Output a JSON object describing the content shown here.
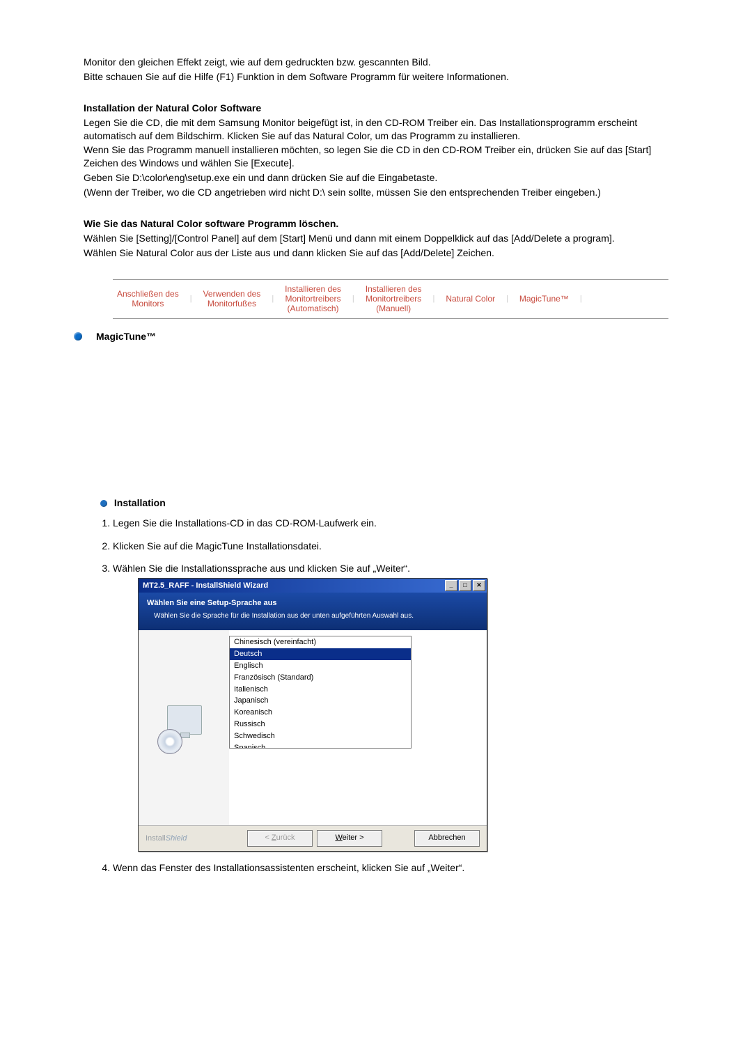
{
  "intro": {
    "p1": "Monitor den gleichen Effekt zeigt, wie auf dem gedruckten bzw. gescannten Bild.",
    "p2": "Bitte schauen Sie auf die Hilfe (F1) Funktion in dem Software Programm für weitere Informationen."
  },
  "install_nc": {
    "heading": "Installation der Natural Color Software",
    "p1": "Legen Sie die CD, die mit dem Samsung Monitor beigefügt ist, in den CD-ROM Treiber ein. Das Installationsprogramm erscheint automatisch auf dem Bildschirm. Klicken Sie auf das Natural Color, um das Programm zu installieren.",
    "p2": "Wenn Sie das Programm manuell installieren möchten, so legen Sie die CD in den CD-ROM Treiber ein, drücken Sie auf das [Start] Zeichen des Windows und wählen Sie [Execute].",
    "p3": "Geben Sie D:\\color\\eng\\setup.exe ein und dann drücken Sie auf die Eingabetaste.",
    "p4": "(Wenn der Treiber, wo die CD angetrieben wird nicht D:\\ sein sollte, müssen Sie den entsprechenden Treiber eingeben.)"
  },
  "remove_nc": {
    "heading": "Wie Sie das Natural Color software Programm löschen.",
    "p1": "Wählen Sie [Setting]/[Control Panel] auf dem [Start] Menü und dann mit einem Doppelklick auf das [Add/Delete a program].",
    "p2": "Wählen Sie Natural Color aus der Liste aus und dann klicken Sie auf das [Add/Delete] Zeichen."
  },
  "nav": [
    "Anschließen des\nMonitors",
    "Verwenden des\nMonitorfußes",
    "Installieren des\nMonitortreibers\n(Automatisch)",
    "Installieren des\nMonitortreibers\n(Manuell)",
    "Natural Color",
    "MagicTune™"
  ],
  "magictune": {
    "heading": "MagicTune™",
    "installation_heading": "Installation",
    "steps": [
      "Legen Sie die Installations-CD in das CD-ROM-Laufwerk ein.",
      "Klicken Sie auf die MagicTune Installationsdatei.",
      "Wählen Sie die Installationssprache aus und klicken Sie auf „Weiter“.",
      "Wenn das Fenster des Installationsassistenten erscheint, klicken Sie auf „Weiter“."
    ]
  },
  "wizard": {
    "title": "MT2.5_RAFF - InstallShield Wizard",
    "header_bold": "Wählen Sie eine Setup-Sprache aus",
    "header_sub": "Wählen Sie die Sprache für die Installation aus der unten aufgeführten Auswahl aus.",
    "options": [
      "Chinesisch (vereinfacht)",
      "Deutsch",
      "Englisch",
      "Französisch (Standard)",
      "Italienisch",
      "Japanisch",
      "Koreanisch",
      "Russisch",
      "Schwedisch",
      "Spanisch"
    ],
    "selected_index": 1,
    "footer_brand_plain": "Install",
    "footer_brand_italic": "Shield",
    "btn_back_prefix": "< ",
    "btn_back_ul": "Z",
    "btn_back_rest": "urück",
    "btn_next_ul": "W",
    "btn_next_rest": "eiter >",
    "btn_cancel": "Abbrechen",
    "win_min": "_",
    "win_max": "□",
    "win_close": "✕"
  }
}
